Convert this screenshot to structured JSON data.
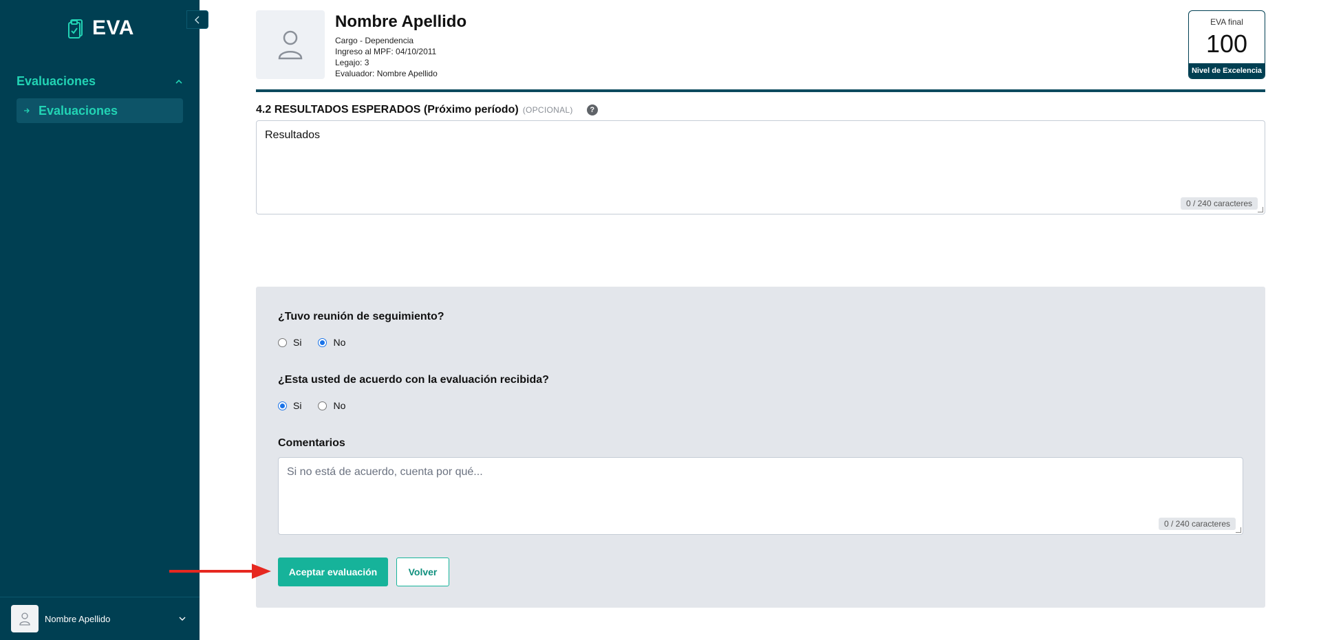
{
  "sidebar": {
    "brand": "EVA",
    "nav_group": "Evaluaciones",
    "nav_item": "Evaluaciones",
    "user_name": "Nombre Apellido"
  },
  "profile": {
    "name": "Nombre Apellido",
    "line1": "Cargo - Dependencia",
    "line2": "Ingreso al MPF: 04/10/2011",
    "line3": "Legajo: 3",
    "line4": "Evaluador: Nombre Apellido"
  },
  "score": {
    "label": "EVA final",
    "value": "100",
    "level": "Nivel de Excelencia"
  },
  "section": {
    "title": "4.2 RESULTADOS ESPERADOS (Próximo período)",
    "optional": "(OPCIONAL)",
    "help": "?",
    "value": "Resultados",
    "counter": "0 / 240 caracteres"
  },
  "panel": {
    "q1": "¿Tuvo reunión de seguimiento?",
    "q1_options": {
      "yes": "Si",
      "no": "No"
    },
    "q1_selected": "No",
    "q2": "¿Esta usted de acuerdo con la evaluación recibida?",
    "q2_options": {
      "yes": "Si",
      "no": "No"
    },
    "q2_selected": "Si",
    "comments_label": "Comentarios",
    "comments_placeholder": "Si no está de acuerdo, cuenta por qué...",
    "comments_counter": "0 / 240 caracteres",
    "accept": "Aceptar evaluación",
    "back": "Volver"
  },
  "colors": {
    "sidebar": "#003f52",
    "accent": "#22d3b4",
    "primary_button": "#16b39a",
    "annotation_arrow": "#e62820"
  }
}
